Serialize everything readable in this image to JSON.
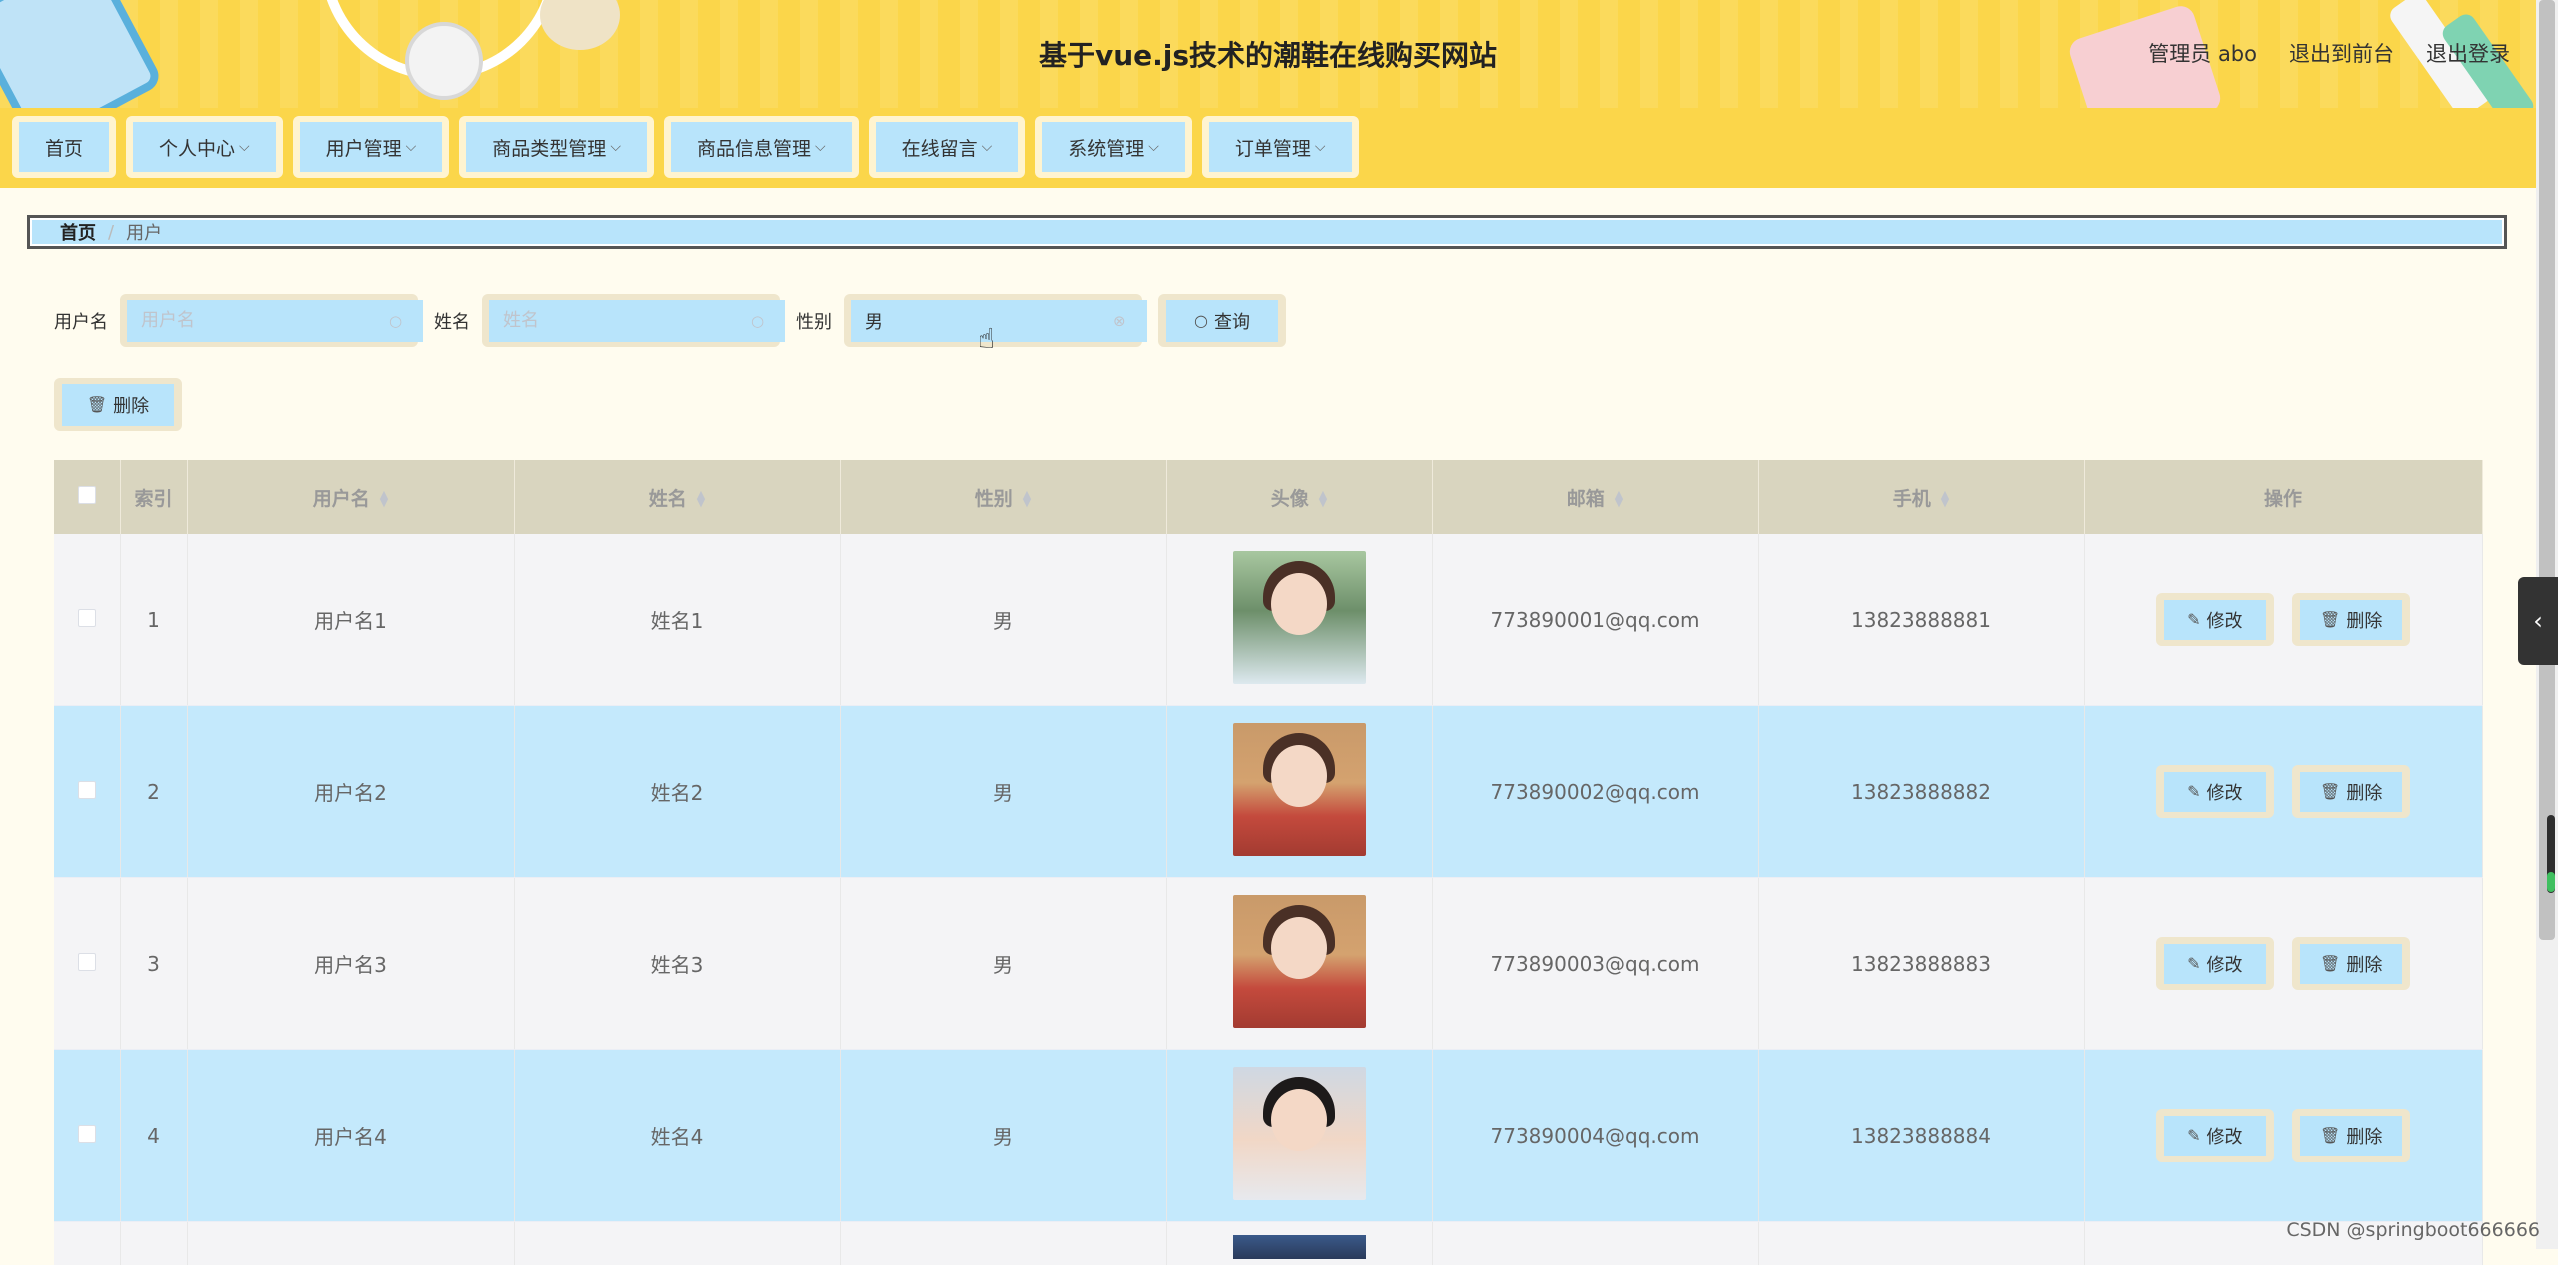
{
  "header": {
    "site_title": "基于vue.js技术的潮鞋在线购买网站",
    "admin_label": "管理员 abo",
    "to_front_label": "退出到前台",
    "logout_label": "退出登录"
  },
  "nav": {
    "items": [
      {
        "label": "首页",
        "has_dropdown": false
      },
      {
        "label": "个人中心",
        "has_dropdown": true
      },
      {
        "label": "用户管理",
        "has_dropdown": true
      },
      {
        "label": "商品类型管理",
        "has_dropdown": true
      },
      {
        "label": "商品信息管理",
        "has_dropdown": true
      },
      {
        "label": "在线留言",
        "has_dropdown": true
      },
      {
        "label": "系统管理",
        "has_dropdown": true
      },
      {
        "label": "订单管理",
        "has_dropdown": true
      }
    ]
  },
  "breadcrumb": {
    "home": "首页",
    "separator": "/",
    "current": "用户"
  },
  "search": {
    "username_label": "用户名",
    "username_placeholder": "用户名",
    "username_value": "",
    "name_label": "姓名",
    "name_placeholder": "姓名",
    "name_value": "",
    "gender_label": "性别",
    "gender_value": "男",
    "query_button": "查询",
    "search_icon": "search-icon",
    "clear_icon": "circle-close-icon"
  },
  "actions": {
    "delete_label": "删除",
    "delete_icon": "trash-icon"
  },
  "table": {
    "columns": [
      "索引",
      "用户名",
      "姓名",
      "性别",
      "头像",
      "邮箱",
      "手机",
      "操作"
    ],
    "rows": [
      {
        "index": "1",
        "username": "用户名1",
        "name": "姓名1",
        "gender": "男",
        "email": "773890001@qq.com",
        "phone": "13823888881"
      },
      {
        "index": "2",
        "username": "用户名2",
        "name": "姓名2",
        "gender": "男",
        "email": "773890002@qq.com",
        "phone": "13823888882"
      },
      {
        "index": "3",
        "username": "用户名3",
        "name": "姓名3",
        "gender": "男",
        "email": "773890003@qq.com",
        "phone": "13823888883"
      },
      {
        "index": "4",
        "username": "用户名4",
        "name": "姓名4",
        "gender": "男",
        "email": "773890004@qq.com",
        "phone": "13823888884"
      }
    ],
    "edit_label": "修改",
    "delete_label": "删除",
    "edit_icon": "edit-icon",
    "delete_icon": "trash-icon"
  },
  "side": {
    "toggle_icon": "chevron-left-icon"
  },
  "watermark": "CSDN @springboot666666",
  "colors": {
    "header_bg": "#fbd64a",
    "button_bg": "#b8e4fb",
    "button_frame": "#efe6cc",
    "table_header_bg": "#d9d5bf",
    "row_stripe": "#c4e9fc",
    "page_bg": "#fffcef"
  }
}
